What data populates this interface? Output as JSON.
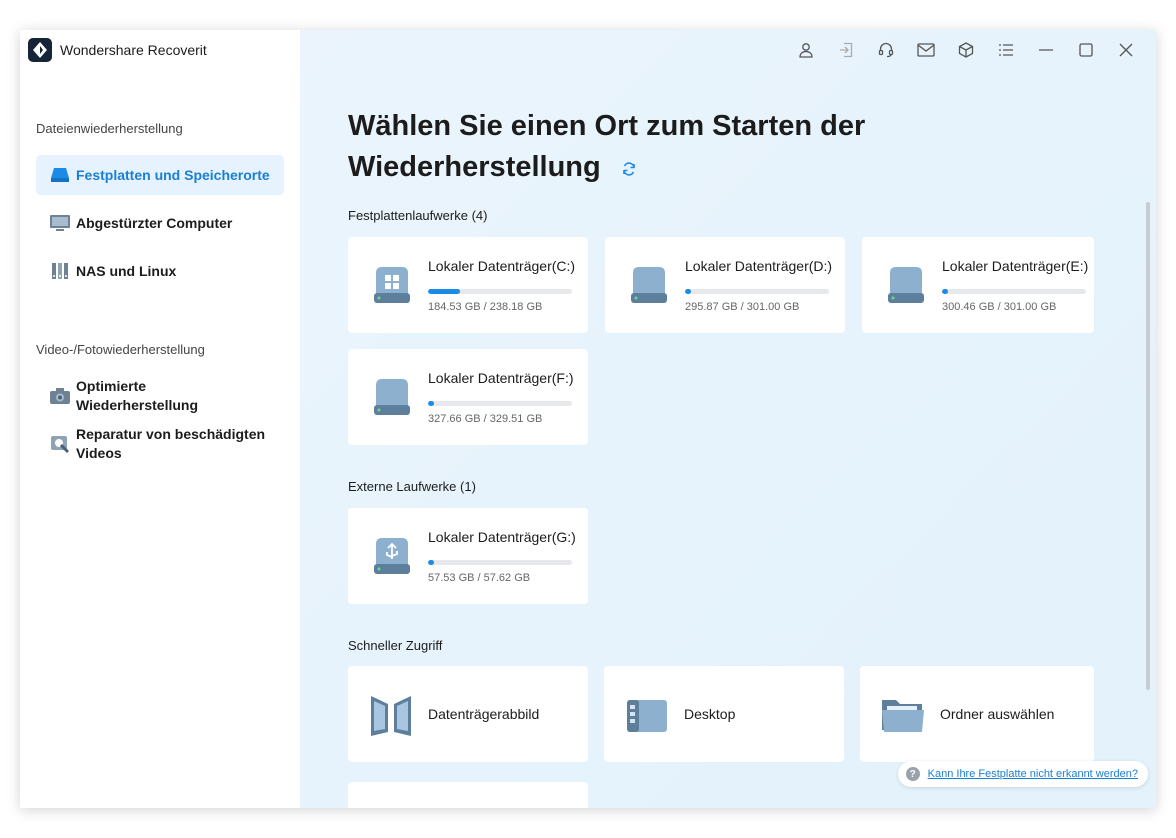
{
  "app": {
    "name": "Wondershare Recoverit"
  },
  "sidebar": {
    "section1_title": "Dateienwiederherstellung",
    "items1": [
      {
        "label": "Festplatten und Speicherorte",
        "icon": "hard-drive-icon",
        "active": true
      },
      {
        "label": "Abgestürzter Computer",
        "icon": "monitor-icon"
      },
      {
        "label": "NAS und Linux",
        "icon": "nas-icon"
      }
    ],
    "section2_title": "Video-/Fotowiederherstellung",
    "items2": [
      {
        "label": "Optimierte Wiederherstellung",
        "icon": "camera-icon"
      },
      {
        "label": "Reparatur von beschädigten Videos",
        "icon": "video-repair-icon"
      }
    ]
  },
  "topbar": {
    "icons": [
      "user-icon",
      "login-icon",
      "headset-icon",
      "mail-icon",
      "box-icon",
      "menu-icon",
      "minimize-icon",
      "maximize-icon",
      "close-icon"
    ]
  },
  "main": {
    "heading": "Wählen Sie einen Ort zum Starten der Wiederherstellung",
    "hard_drives_title": "Festplattenlaufwerke (4)",
    "hard_drives": [
      {
        "name": "Lokaler Datenträger(C:)",
        "size": "184.53 GB / 238.18 GB",
        "used_fraction": 0.22,
        "type": "windows"
      },
      {
        "name": "Lokaler Datenträger(D:)",
        "size": "295.87 GB / 301.00 GB",
        "used_fraction": 0.04,
        "type": "plain"
      },
      {
        "name": "Lokaler Datenträger(E:)",
        "size": "300.46 GB / 301.00 GB",
        "used_fraction": 0.04,
        "type": "plain"
      },
      {
        "name": "Lokaler Datenträger(F:)",
        "size": "327.66 GB / 329.51 GB",
        "used_fraction": 0.04,
        "type": "plain"
      }
    ],
    "external_title": "Externe Laufwerke (1)",
    "external": [
      {
        "name": "Lokaler Datenträger(G:)",
        "size": "57.53 GB / 57.62 GB",
        "used_fraction": 0.04,
        "type": "usb"
      }
    ],
    "quick_title": "Schneller Zugriff",
    "quick": [
      {
        "label": "Datenträgerabbild",
        "icon": "disk-image-icon"
      },
      {
        "label": "Desktop",
        "icon": "desktop-icon"
      },
      {
        "label": "Ordner auswählen",
        "icon": "folder-icon"
      }
    ],
    "help_link": "Kann Ihre Festplatte nicht erkannt werden?"
  },
  "colors": {
    "accent": "#1a8be6",
    "active_bg": "#e6f2fd",
    "main_bg": "#e8f4fc"
  }
}
